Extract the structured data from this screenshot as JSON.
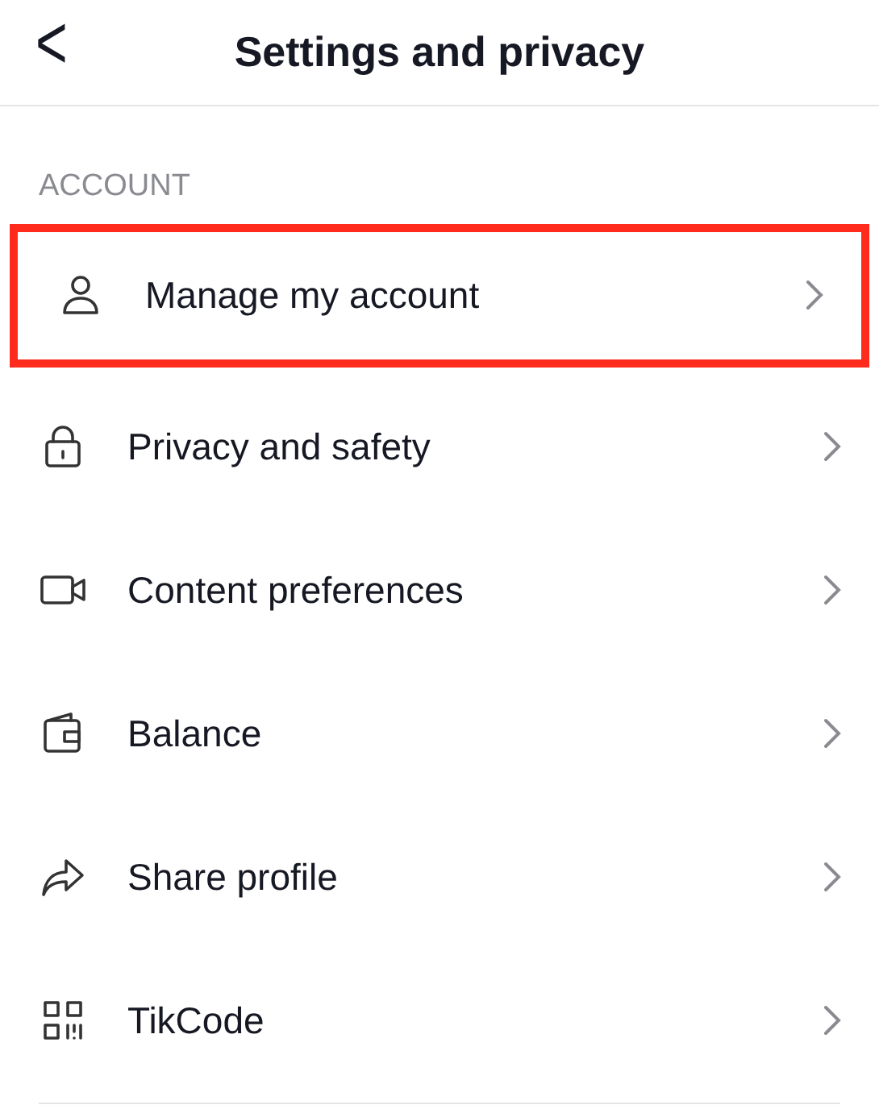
{
  "header": {
    "back": "<",
    "title": "Settings and privacy"
  },
  "section": {
    "title": "ACCOUNT"
  },
  "items": [
    {
      "label": "Manage my account",
      "highlighted": true
    },
    {
      "label": "Privacy and safety",
      "highlighted": false
    },
    {
      "label": "Content preferences",
      "highlighted": false
    },
    {
      "label": "Balance",
      "highlighted": false
    },
    {
      "label": "Share profile",
      "highlighted": false
    },
    {
      "label": "TikCode",
      "highlighted": false
    }
  ]
}
